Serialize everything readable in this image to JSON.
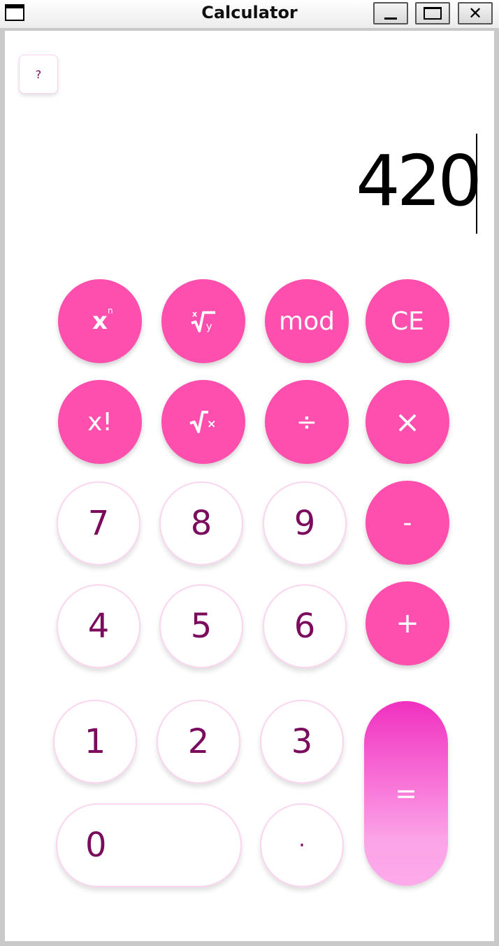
{
  "window": {
    "title": "Calculator",
    "controls": {
      "minimize": "_",
      "maximize": "□",
      "close": "✕"
    }
  },
  "help_button": {
    "label": "?"
  },
  "display": {
    "value": "420"
  },
  "keypad": {
    "row1": {
      "power": "xⁿ",
      "nth_root": "ˣ√y",
      "mod": "mod",
      "clear_entry": "CE"
    },
    "row2": {
      "factorial": "x!",
      "sqrt": "√x",
      "divide": "÷",
      "multiply": "×"
    },
    "row3": {
      "seven": "7",
      "eight": "8",
      "nine": "9",
      "minus": "-"
    },
    "row4": {
      "four": "4",
      "five": "5",
      "six": "6",
      "plus": "+"
    },
    "row5": {
      "one": "1",
      "two": "2",
      "three": "3",
      "equals": "="
    },
    "row6": {
      "zero": "0",
      "decimal": "·"
    }
  },
  "colors": {
    "accent_pink": "#ff4fae",
    "digit_text": "#7a0b5d",
    "digit_border": "#fbd6ee",
    "equals_gradient_top": "#f030c0",
    "equals_gradient_bottom": "#fdaaea"
  }
}
